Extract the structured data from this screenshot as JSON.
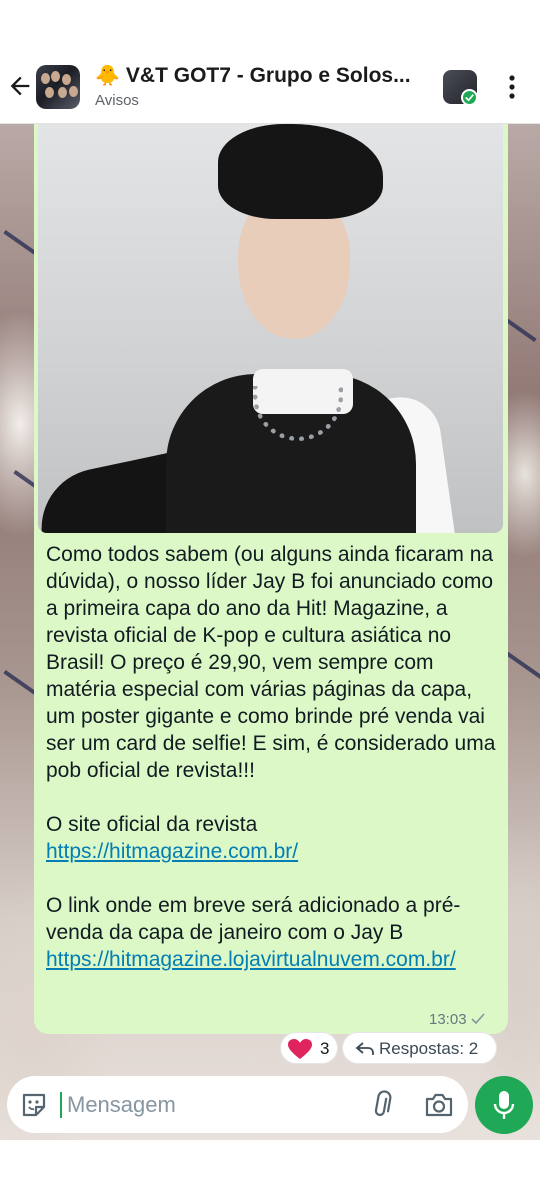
{
  "header": {
    "title_emoji": "🐥",
    "title": "V&T GOT7 - Grupo e Solos...",
    "subtitle": "Avisos",
    "back_icon": "arrow-left-icon",
    "menu_icon": "kebab-menu-icon"
  },
  "message": {
    "paragraph_1": "Como todos sabem (ou alguns ainda ficaram na dúvida), o nosso líder Jay B foi anunciado como a primeira capa do ano da Hit! Magazine, a revista oficial de K-pop e cultura asiática no Brasil! O preço é 29,90, vem sempre com matéria especial com várias páginas da capa, um poster gigante e como brinde pré venda vai ser um card de selfie! E sim, é considerado uma pob oficial de revista!!!",
    "site_prefix": "O site oficial da revista ",
    "site_link": "https://hitmagazine.com.br/",
    "link_prefix": "O link onde em breve será adicionado a pré-venda da capa de janeiro com o Jay B ",
    "presale_link": "https://hitmagazine.lojavirtualnuvem.com.br/",
    "time": "13:03",
    "bubble_color": "#dcf8c6",
    "link_color": "#027eb5"
  },
  "reactions": {
    "emoji": "heart-icon",
    "count": "3"
  },
  "replies": {
    "label": "Respostas: 2"
  },
  "composer": {
    "placeholder": "Mensagem",
    "accent_color": "#1fa855"
  }
}
